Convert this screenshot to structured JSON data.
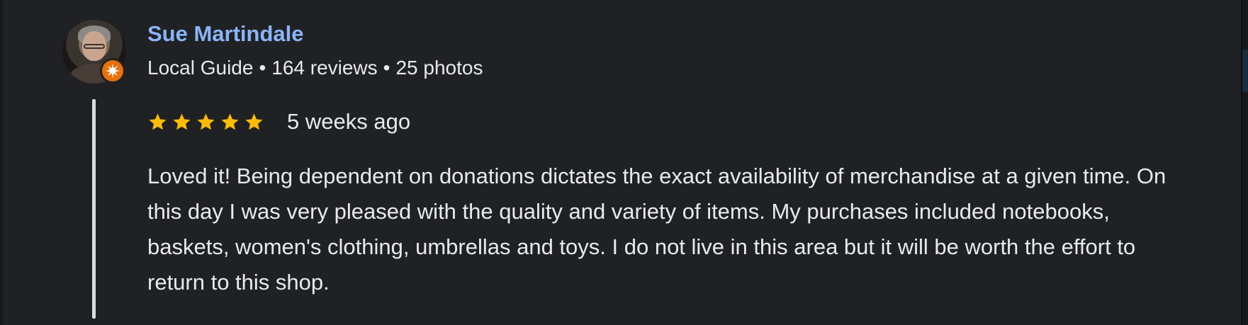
{
  "reviewer": {
    "name": "Sue Martindale",
    "badge": "Local Guide",
    "reviews_count": "164 reviews",
    "photos_count": "25 photos",
    "separator": "•"
  },
  "review": {
    "rating": 5,
    "rating_max": 5,
    "date": "5 weeks ago",
    "text": "Loved it! Being dependent on donations dictates the exact availability of merchandise at a given time. On this day I was very pleased with the quality and variety of items. My purchases included notebooks, baskets, women's clothing, umbrellas and toys. I do not live in this area but it will be worth the effort to return to this shop."
  },
  "icons": {
    "star": "star-icon",
    "guide_badge": "local-guide-badge-icon"
  },
  "colors": {
    "background": "#202124",
    "name": "#8ab4f8",
    "text": "#e8eaed",
    "star": "#fbbc04",
    "badge": "#e8710a",
    "thread_line": "#dadce0"
  }
}
